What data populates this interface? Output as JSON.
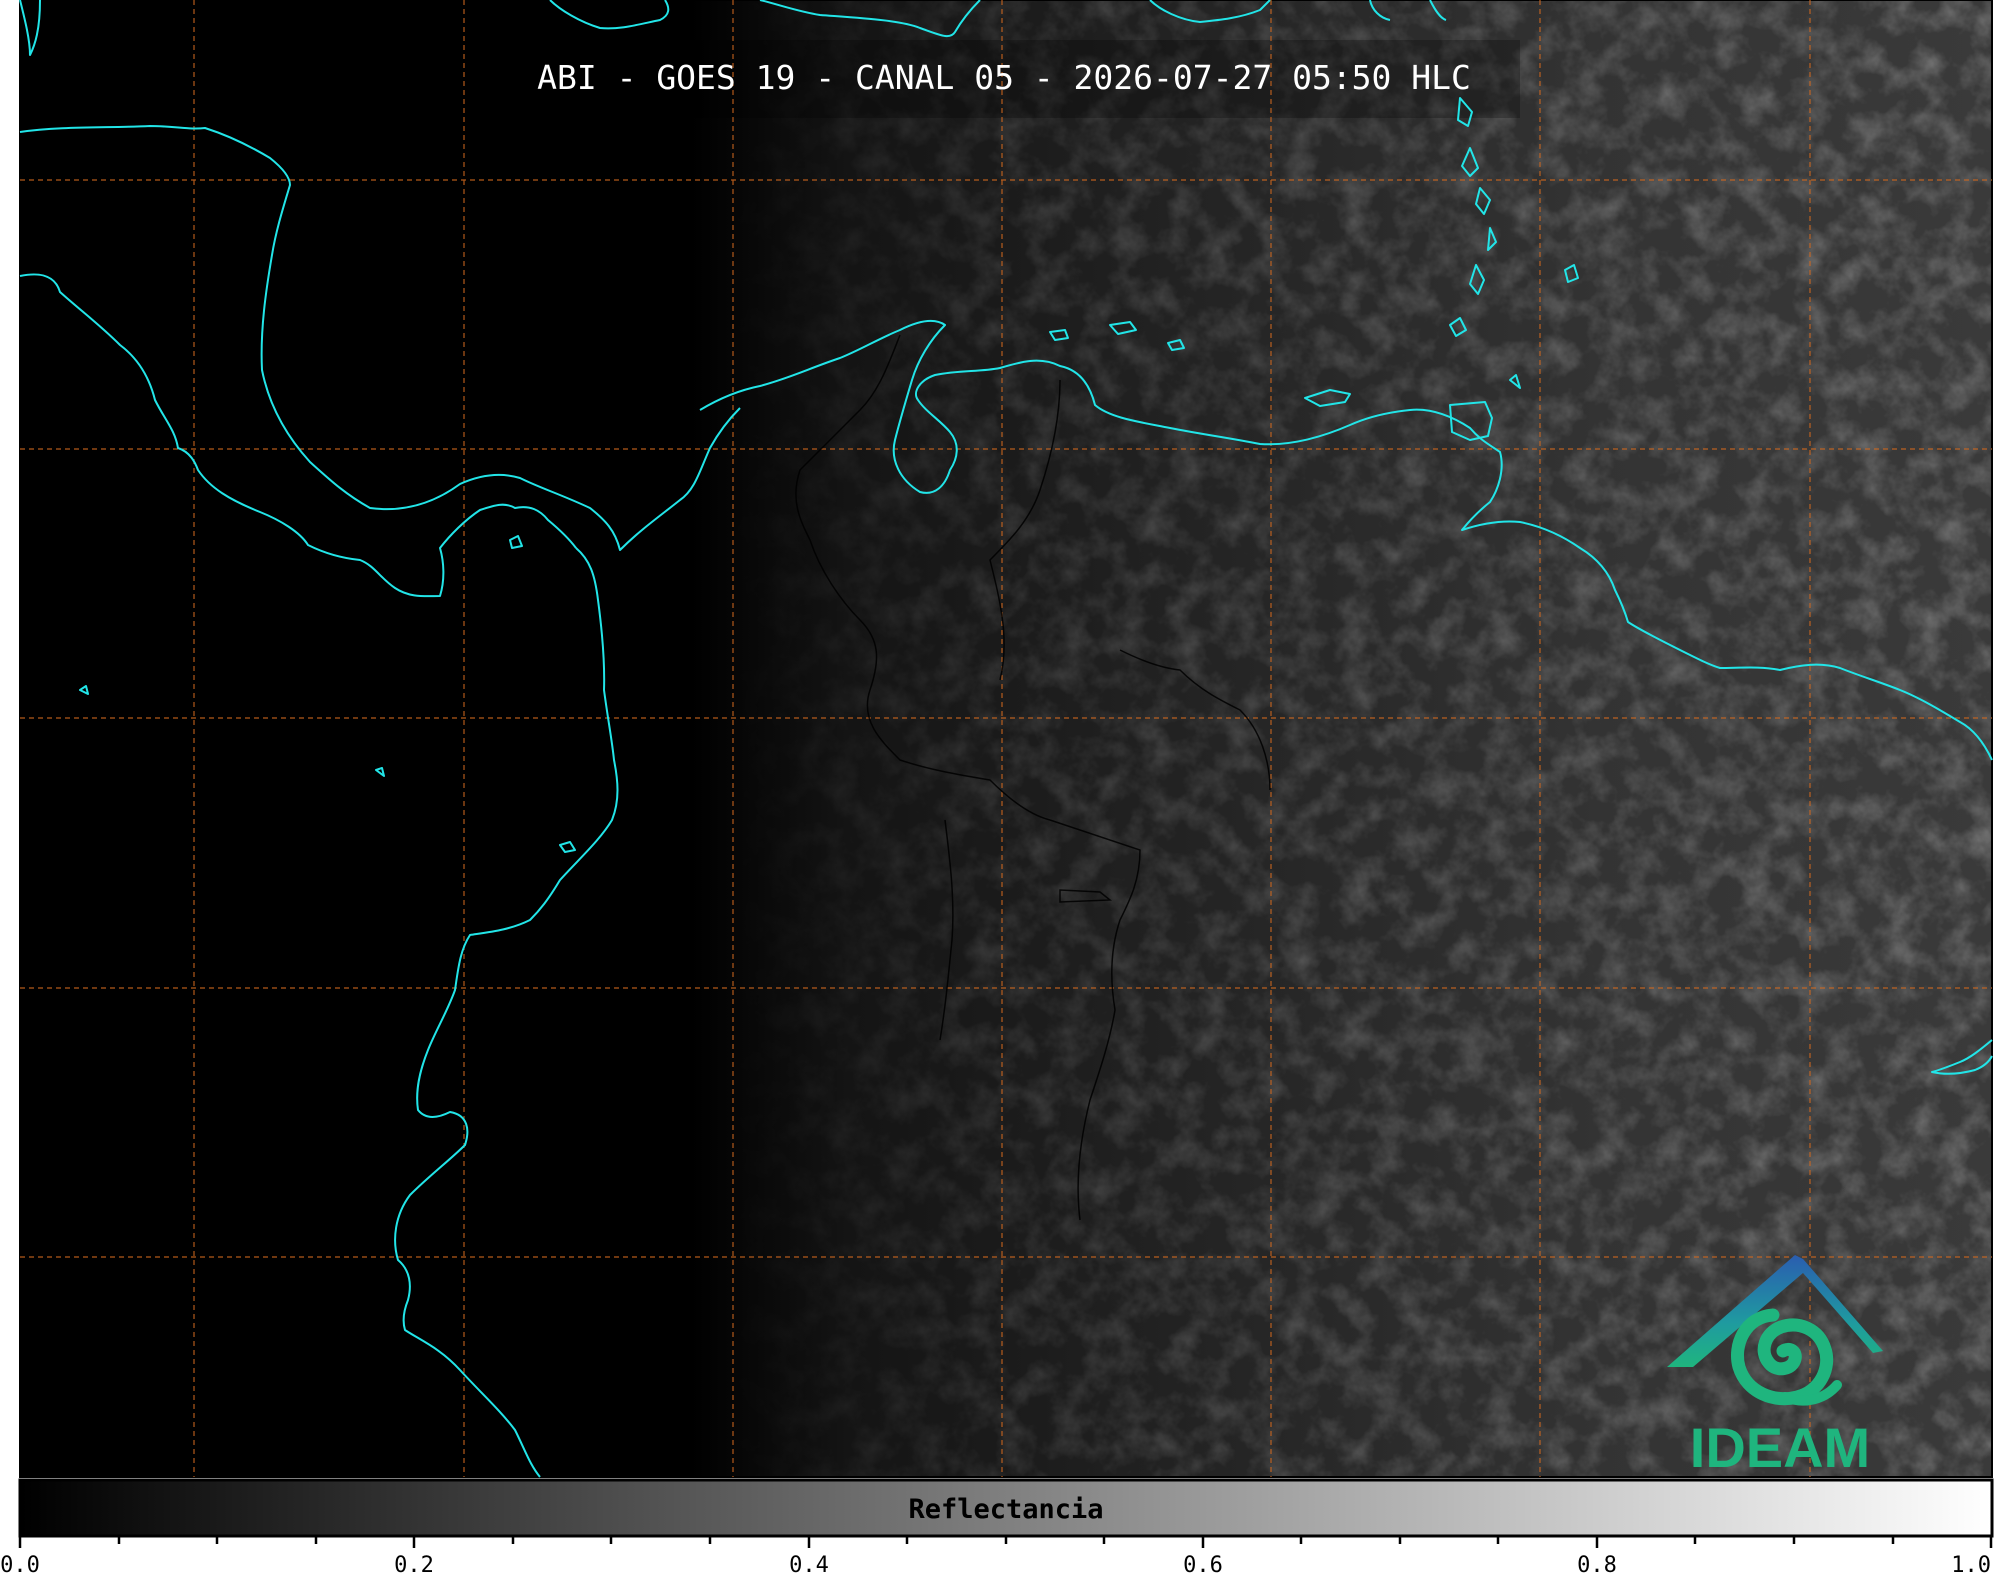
{
  "map": {
    "title": "ABI - GOES 19 - CANAL 05 - 2026-07-27 05:50 HLC",
    "coastline_color": "#22e5e8",
    "graticule_color": "#d2691e",
    "background_color": "#000000"
  },
  "logo": {
    "text": "IDEAM",
    "icon": "ideam-logo-icon"
  },
  "colorbar": {
    "label": "Reflectancia",
    "ticks": [
      "0.0",
      "0.2",
      "0.4",
      "0.6",
      "0.8",
      "1.0"
    ],
    "min": 0.0,
    "max": 1.0,
    "colormap": "grayscale"
  }
}
